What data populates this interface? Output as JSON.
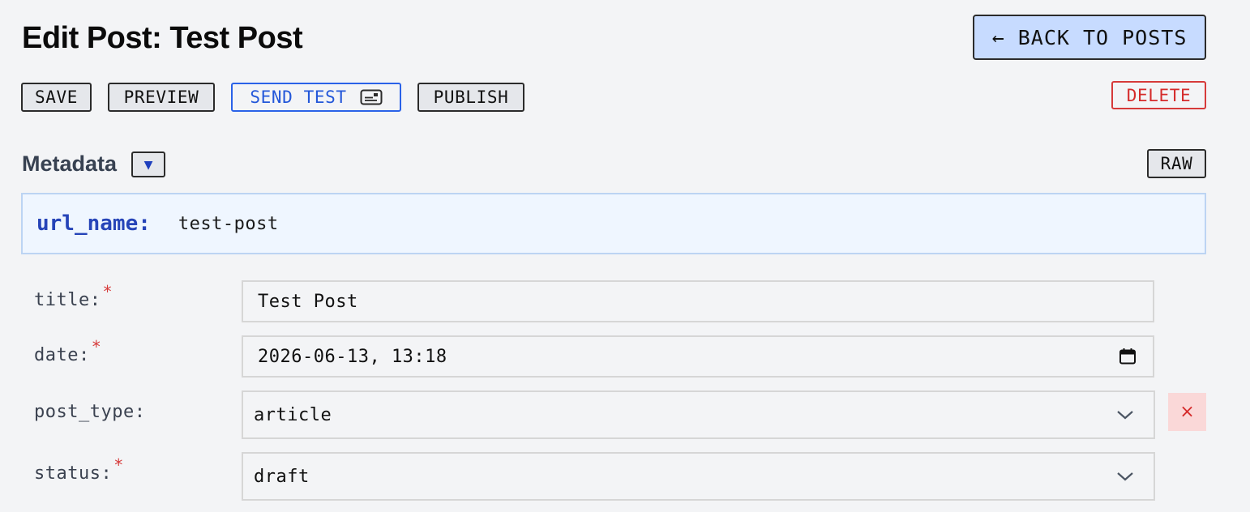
{
  "header": {
    "title": "Edit Post: Test Post",
    "back_label": "← BACK TO POSTS"
  },
  "toolbar": {
    "save_label": "SAVE",
    "preview_label": "PREVIEW",
    "send_test_label": "SEND TEST",
    "publish_label": "PUBLISH",
    "delete_label": "DELETE"
  },
  "metadata": {
    "section_title": "Metadata",
    "toggle_symbol": "▼",
    "raw_label": "RAW",
    "url_name": {
      "key": "url_name:",
      "value": "test-post"
    },
    "fields": {
      "title": {
        "label": "title:",
        "required": "*",
        "value": "Test Post"
      },
      "date": {
        "label": "date:",
        "required": "*",
        "value": "2026-06-13, 13:18"
      },
      "post_type": {
        "label": "post_type:",
        "value": "article",
        "remove_symbol": "×"
      },
      "status": {
        "label": "status:",
        "required": "*",
        "value": "draft"
      }
    }
  },
  "colors": {
    "accent_blue": "#2a62e8",
    "danger_red": "#d63a3a",
    "back_button_bg": "#c7dbff",
    "urlname_bg": "#eff6ff"
  },
  "icons": {
    "send_test": "send-card-icon",
    "date": "calendar-icon",
    "select": "chevron-down-icon"
  }
}
